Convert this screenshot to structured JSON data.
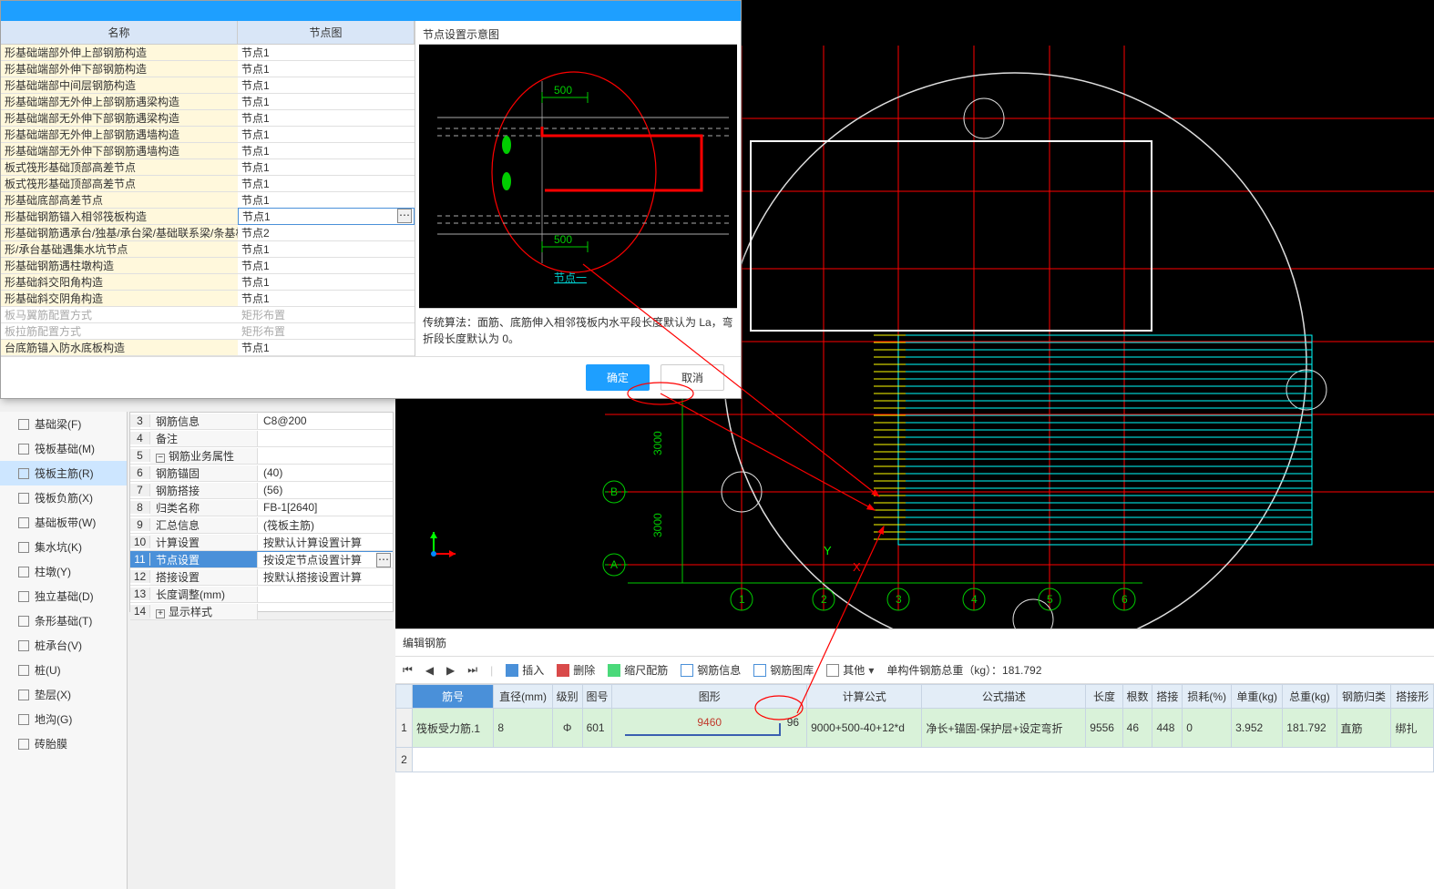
{
  "dialog": {
    "headers": {
      "name": "名称",
      "node": "节点图"
    },
    "rows": [
      {
        "name": "形基础端部外伸上部钢筋构造",
        "node": "节点1"
      },
      {
        "name": "形基础端部外伸下部钢筋构造",
        "node": "节点1"
      },
      {
        "name": "形基础端部中间层钢筋构造",
        "node": "节点1"
      },
      {
        "name": "形基础端部无外伸上部钢筋遇梁构造",
        "node": "节点1"
      },
      {
        "name": "形基础端部无外伸下部钢筋遇梁构造",
        "node": "节点1"
      },
      {
        "name": "形基础端部无外伸上部钢筋遇墙构造",
        "node": "节点1"
      },
      {
        "name": "形基础端部无外伸下部钢筋遇墙构造",
        "node": "节点1"
      },
      {
        "name": "板式筏形基础顶部高差节点",
        "node": "节点1"
      },
      {
        "name": "板式筏形基础顶部高差节点",
        "node": "节点1"
      },
      {
        "name": "形基础底部高差节点",
        "node": "节点1"
      },
      {
        "name": "形基础钢筋锚入相邻筏板构造",
        "node": "节点1",
        "sel": true
      },
      {
        "name": "形基础钢筋遇承台/独基/承台梁/基础联系梁/条基构造",
        "node": "节点2"
      },
      {
        "name": "形/承台基础遇集水坑节点",
        "node": "节点1"
      },
      {
        "name": "形基础钢筋遇柱墩构造",
        "node": "节点1"
      },
      {
        "name": "形基础斜交阳角构造",
        "node": "节点1"
      },
      {
        "name": "形基础斜交阴角构造",
        "node": "节点1"
      },
      {
        "name": "板马翼筋配置方式",
        "node": "矩形布置",
        "disabled": true
      },
      {
        "name": "板拉筋配置方式",
        "node": "矩形布置",
        "disabled": true
      },
      {
        "name": "台底筋锚入防水底板构造",
        "node": "节点1"
      }
    ],
    "preview": {
      "title": "节点设置示意图",
      "dim_top": "500",
      "dim_bottom": "500",
      "caption": "节点一",
      "desc": "传统算法：面筋、底筋伸入相邻筏板内水平段长度默认为 La，弯折段长度默认为 0。"
    },
    "ok": "确定",
    "cancel": "取消"
  },
  "components": [
    {
      "label": "基础梁(F)",
      "icon": "beam-icon"
    },
    {
      "label": "筏板基础(M)",
      "icon": "raft-icon"
    },
    {
      "label": "筏板主筋(R)",
      "icon": "rebar-icon",
      "active": true
    },
    {
      "label": "筏板负筋(X)",
      "icon": "neg-rebar-icon"
    },
    {
      "label": "基础板带(W)",
      "icon": "strip-icon"
    },
    {
      "label": "集水坑(K)",
      "icon": "sump-icon"
    },
    {
      "label": "柱墩(Y)",
      "icon": "pier-icon"
    },
    {
      "label": "独立基础(D)",
      "icon": "iso-icon"
    },
    {
      "label": "条形基础(T)",
      "icon": "strip-found-icon"
    },
    {
      "label": "桩承台(V)",
      "icon": "cap-icon"
    },
    {
      "label": "桩(U)",
      "icon": "pile-icon"
    },
    {
      "label": "垫层(X)",
      "icon": "bedding-icon"
    },
    {
      "label": "地沟(G)",
      "icon": "trench-icon"
    },
    {
      "label": "砖胎膜",
      "icon": "brick-icon"
    }
  ],
  "props": [
    {
      "n": "3",
      "k": "钢筋信息",
      "v": "C8@200"
    },
    {
      "n": "4",
      "k": "备注",
      "v": ""
    },
    {
      "n": "5",
      "k": "钢筋业务属性",
      "v": "",
      "group": true
    },
    {
      "n": "6",
      "k": "钢筋锚固",
      "v": "(40)"
    },
    {
      "n": "7",
      "k": "钢筋搭接",
      "v": "(56)"
    },
    {
      "n": "8",
      "k": "归类名称",
      "v": "FB-1[2640]"
    },
    {
      "n": "9",
      "k": "汇总信息",
      "v": "(筏板主筋)"
    },
    {
      "n": "10",
      "k": "计算设置",
      "v": "按默认计算设置计算"
    },
    {
      "n": "11",
      "k": "节点设置",
      "v": "按设定节点设置计算",
      "sel": true
    },
    {
      "n": "12",
      "k": "搭接设置",
      "v": "按默认搭接设置计算"
    },
    {
      "n": "13",
      "k": "长度调整(mm)",
      "v": ""
    },
    {
      "n": "14",
      "k": "显示样式",
      "v": "",
      "group": true,
      "collapsed": true
    }
  ],
  "viewport": {
    "dims": {
      "d1": "3000",
      "d2": "3000"
    },
    "grid_letters": [
      "B",
      "A"
    ],
    "grid_nums": [
      "1",
      "2",
      "3",
      "4",
      "5",
      "6"
    ]
  },
  "bottom": {
    "title": "编辑钢筋",
    "toolbar": {
      "insert": "插入",
      "delete": "删除",
      "scale": "缩尺配筋",
      "info": "钢筋信息",
      "lib": "钢筋图库",
      "other": "其他",
      "weight_label": "单构件钢筋总重（kg）：",
      "weight_value": "181.792"
    },
    "headers": [
      "筋号",
      "直径(mm)",
      "级别",
      "图号",
      "图形",
      "计算公式",
      "公式描述",
      "长度",
      "根数",
      "搭接",
      "损耗(%)",
      "单重(kg)",
      "总重(kg)",
      "钢筋归类",
      "搭接形"
    ],
    "row": {
      "idx": "1",
      "name": "筏板受力筋.1",
      "dia": "8",
      "grade": "Φ",
      "shape_no": "601",
      "shape_val": "9460",
      "shape_hook": "96",
      "formula": "9000+500-40+12*d",
      "desc": "净长+锚固-保护层+设定弯折",
      "len": "9556",
      "count": "46",
      "lap": "448",
      "loss": "0",
      "unit": "3.952",
      "total": "181.792",
      "cat": "直筋",
      "lap_type": "绑扎"
    }
  }
}
